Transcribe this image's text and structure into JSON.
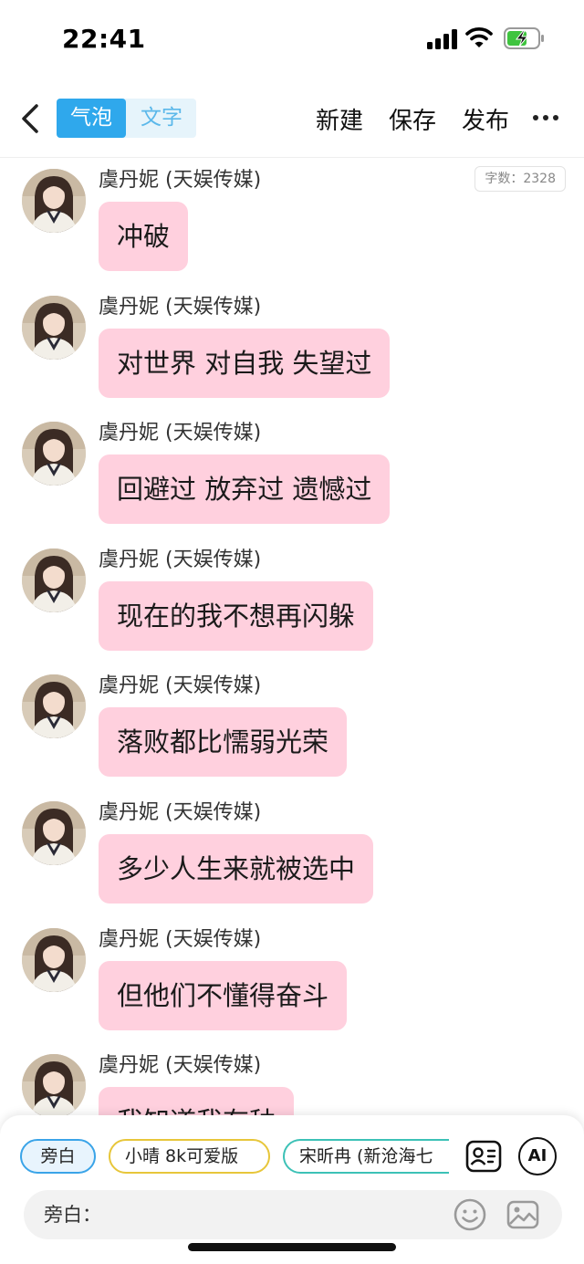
{
  "status_bar": {
    "time": "22:41"
  },
  "header": {
    "segments": [
      "气泡",
      "文字"
    ],
    "active_segment": "气泡",
    "actions": {
      "new": "新建",
      "save": "保存",
      "publish": "发布"
    }
  },
  "chat": {
    "word_count": "字数：2328",
    "messages": [
      {
        "sender": "虞丹妮 (天娱传媒)",
        "text": "冲破"
      },
      {
        "sender": "虞丹妮 (天娱传媒)",
        "text": "对世界 对自我 失望过"
      },
      {
        "sender": "虞丹妮 (天娱传媒)",
        "text": "回避过 放弃过 遗憾过"
      },
      {
        "sender": "虞丹妮 (天娱传媒)",
        "text": "现在的我不想再闪躲"
      },
      {
        "sender": "虞丹妮 (天娱传媒)",
        "text": "落败都比懦弱光荣"
      },
      {
        "sender": "虞丹妮 (天娱传媒)",
        "text": "多少人生来就被选中"
      },
      {
        "sender": "虞丹妮 (天娱传媒)",
        "text": "但他们不懂得奋斗"
      },
      {
        "sender": "虞丹妮 (天娱传媒)",
        "text": "我知道我有种"
      }
    ]
  },
  "bottom": {
    "roles": [
      "旁白",
      "小晴 8k可爱版",
      "宋昕冉 (新沧海七"
    ],
    "selected_role": "旁白",
    "ai_label": "AI",
    "input_label": "旁白：",
    "input_value": "",
    "input_placeholder": ""
  },
  "icons": {
    "back": "chevron-left-icon",
    "more": "more-horizontal-icon",
    "character_card": "character-card-icon",
    "emoji": "emoji-icon",
    "image": "image-icon"
  },
  "colors": {
    "accent": "#2fa8ec",
    "bubble": "#ffd0de",
    "segment_bg": "#e6f4fb",
    "chip_yellow": "#e7c63a",
    "chip_teal": "#3cc1b6"
  }
}
